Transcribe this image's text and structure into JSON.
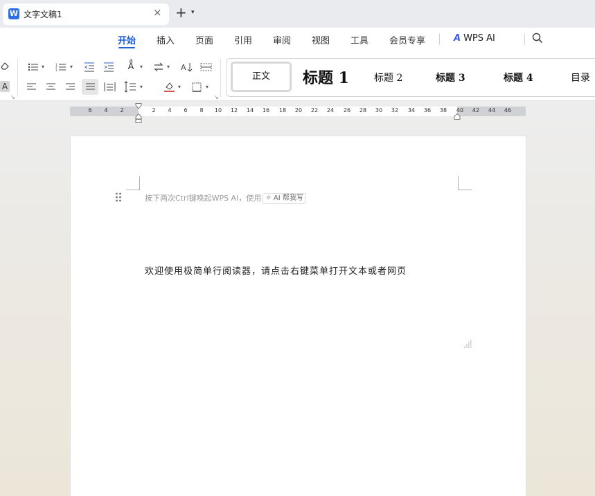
{
  "tab": {
    "logo_letter": "W",
    "title": "文字文稿1",
    "close_glyph": "×",
    "new_tab_glyph": "+",
    "new_tab_caret": "⌄"
  },
  "menu": {
    "items": [
      "开始",
      "插入",
      "页面",
      "引用",
      "审阅",
      "视图",
      "工具",
      "会员专享"
    ],
    "active_index": 0,
    "wps_ai_label": "WPS AI"
  },
  "ribbon": {
    "eraser_icon": "eraser-icon",
    "char_shading_label": "A",
    "styles": {
      "normal": "正文",
      "heading1": "标题 1",
      "heading2": "标题 2",
      "heading3": "标题 3",
      "heading4": "标题 4",
      "toc": "目录"
    }
  },
  "ruler": {
    "left_numbers": [
      "6",
      "4",
      "2"
    ],
    "right_numbers": [
      "2",
      "4",
      "6",
      "8",
      "10",
      "12",
      "14",
      "16",
      "18",
      "20",
      "22",
      "24",
      "26",
      "28",
      "30",
      "32",
      "34",
      "36",
      "38",
      "40",
      "42",
      "44",
      "46"
    ]
  },
  "document": {
    "ai_hint": "按下两次Ctrl键唤起WPS AI，使用",
    "ai_chip": "AI 帮我写",
    "body_text": "欢迎使用极简单行阅读器，请点击右键菜单打开文本或者网页"
  },
  "colors": {
    "accent": "#1e5fd8",
    "wps_logo": "#2f6fe4",
    "ai_icon": "#3a5de8"
  }
}
